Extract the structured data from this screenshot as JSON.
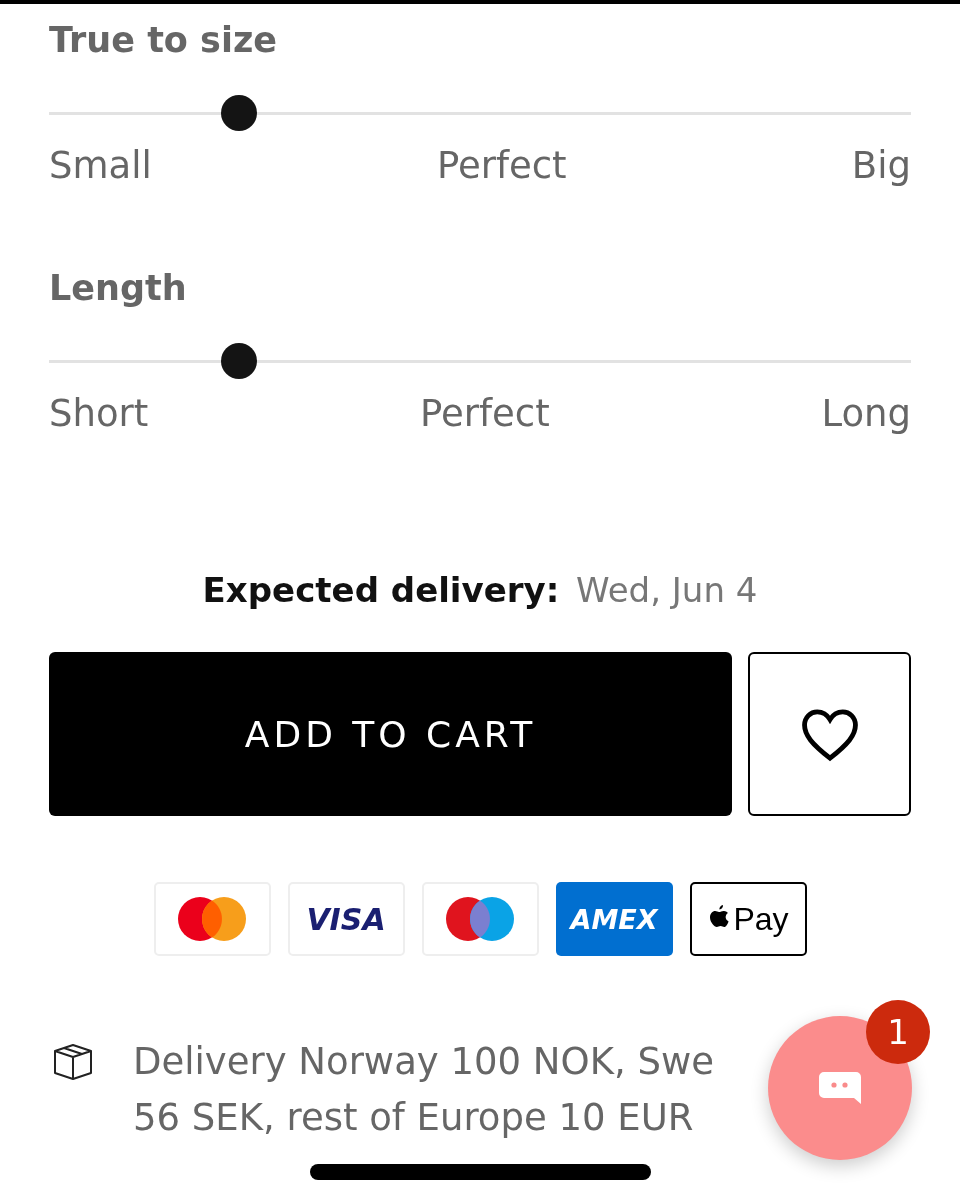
{
  "sliders": [
    {
      "title": "True to size",
      "level": 0.22,
      "labels": [
        "Small",
        "Perfect",
        "Big"
      ]
    },
    {
      "title": "Length",
      "level": 0.22,
      "labels": [
        "Short",
        "Perfect",
        "Long"
      ]
    }
  ],
  "delivery_estimate": {
    "label": "Expected delivery:",
    "value": "Wed, Jun 4"
  },
  "add_to_cart": {
    "label": "ADD TO CART"
  },
  "wishlist": {
    "selected": false
  },
  "payment_methods": [
    {
      "kind": "mastercard"
    },
    {
      "kind": "visa",
      "text": "VISA"
    },
    {
      "kind": "maestro"
    },
    {
      "kind": "amex",
      "text": "AMEX"
    },
    {
      "kind": "applepay",
      "text": "Pay"
    }
  ],
  "shipping": {
    "lines": [
      "Delivery Norway 100 NOK, Swe",
      "56 SEK, rest of Europe 10 EUR"
    ]
  },
  "chat": {
    "badge": "1"
  }
}
